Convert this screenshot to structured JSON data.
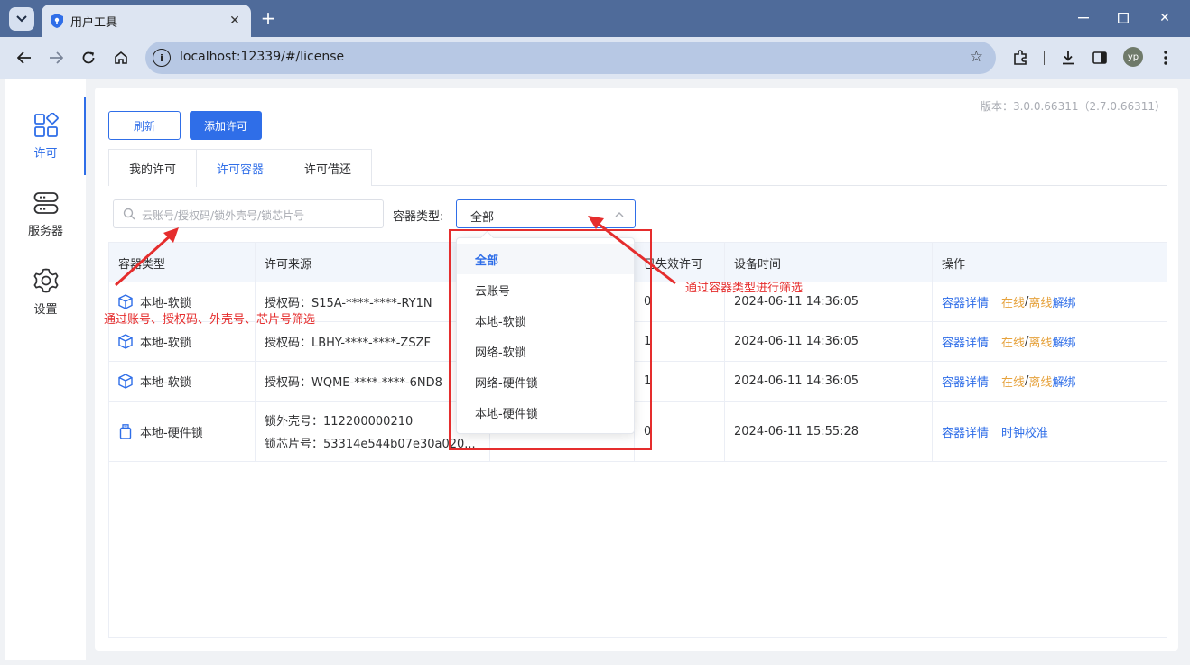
{
  "browser": {
    "tab_title": "用户工具",
    "url": "localhost:12339/#/license",
    "profile_initials": "yp"
  },
  "sidebar": {
    "items": [
      {
        "label": "许可",
        "icon": "apps-icon",
        "active": true
      },
      {
        "label": "服务器",
        "icon": "server-icon",
        "active": false
      },
      {
        "label": "设置",
        "icon": "gear-icon",
        "active": false
      }
    ]
  },
  "header": {
    "version": "版本：3.0.0.66311（2.7.0.66311）",
    "refresh_label": "刷新",
    "add_label": "添加许可"
  },
  "tabs": [
    {
      "label": "我的许可",
      "active": false
    },
    {
      "label": "许可容器",
      "active": true
    },
    {
      "label": "许可借还",
      "active": false
    }
  ],
  "filter": {
    "search_placeholder": "云账号/授权码/锁外壳号/锁芯片号",
    "type_label": "容器类型:",
    "type_value": "全部",
    "options": [
      "全部",
      "云账号",
      "本地-软锁",
      "网络-软锁",
      "网络-硬件锁",
      "本地-硬件锁"
    ]
  },
  "table": {
    "columns": {
      "type": "容器类型",
      "source": "许可来源",
      "invalid": "已失效许可",
      "time": "设备时间",
      "ops": "操作"
    },
    "rows": [
      {
        "type": "本地-软锁",
        "icon": "cube-icon",
        "source1": "授权码：S15A-****-****-RY1N",
        "source2": "",
        "invalid": "0",
        "time": "2024-06-11 14:36:05",
        "op1": "容器详情",
        "op2a": "在线",
        "op2b": "离线",
        "op2c": "解绑"
      },
      {
        "type": "本地-软锁",
        "icon": "cube-icon",
        "source1": "授权码：LBHY-****-****-ZSZF",
        "source2": "",
        "invalid": "1",
        "time": "2024-06-11 14:36:05",
        "op1": "容器详情",
        "op2a": "在线",
        "op2b": "离线",
        "op2c": "解绑"
      },
      {
        "type": "本地-软锁",
        "icon": "cube-icon",
        "source1": "授权码：WQME-****-****-6ND8",
        "source2": "",
        "invalid": "1",
        "time": "2024-06-11 14:36:05",
        "op1": "容器详情",
        "op2a": "在线",
        "op2b": "离线",
        "op2c": "解绑"
      },
      {
        "type": "本地-硬件锁",
        "icon": "usb-key-icon",
        "source1": "锁外壳号：112200000210",
        "source2": "锁芯片号：53314e544b07e30a020...",
        "invalid": "0",
        "time": "2024-06-11 15:55:28",
        "op1": "容器详情",
        "op2": "时钟校准"
      }
    ]
  },
  "annotations": {
    "search_note": "通过账号、授权码、外壳号、芯片号筛选",
    "type_note": "通过容器类型进行筛选"
  },
  "colors": {
    "primary": "#2f6ee8",
    "warning": "#e6a23c",
    "annotation": "#e52d2d"
  }
}
